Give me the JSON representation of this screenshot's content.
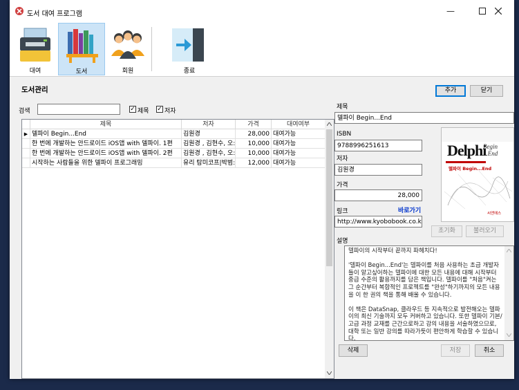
{
  "window": {
    "title": "도서 대여 프로그램",
    "min_icon": "minimize-icon",
    "max_icon": "maximize-icon",
    "close_icon": "close-icon"
  },
  "toolbar": {
    "items": [
      {
        "label": "대여",
        "icon": "rental-printer-icon",
        "selected": false
      },
      {
        "label": "도서",
        "icon": "books-icon",
        "selected": true
      },
      {
        "label": "회원",
        "icon": "members-icon",
        "selected": false
      },
      {
        "label": "종료",
        "icon": "exit-icon",
        "selected": false
      }
    ]
  },
  "page": {
    "title": "도서관리",
    "add_label": "추가",
    "close_label": "닫기"
  },
  "search": {
    "label": "검색",
    "value": "",
    "title_checkbox": "제목",
    "author_checkbox": "저자",
    "title_checked": true,
    "author_checked": true
  },
  "grid": {
    "columns": [
      "제목",
      "저자",
      "가격",
      "대여여부"
    ],
    "rows": [
      {
        "title": "델파이 Begin...End",
        "author": "김원경",
        "price": "28,000",
        "status": "대여가능",
        "current": true
      },
      {
        "title": "한 번에 개발하는 안드로이드 iOS앱 with 델파이. 1편",
        "author": "김원경 , 김현수, 오:",
        "price": "10,000",
        "status": "대여가능",
        "current": false
      },
      {
        "title": "한 번에 개발하는 안드로이드 iOS앱 with 델파이. 2편",
        "author": "김원경 , 김현수, 오:",
        "price": "10,000",
        "status": "대여가능",
        "current": false
      },
      {
        "title": "시작하는 사람들을 위한 델파이 프로그래밍",
        "author": "유리 탐미코프|박범:",
        "price": "12,000",
        "status": "대여가능",
        "current": false
      }
    ]
  },
  "detail": {
    "title_label": "제목",
    "title_value": "델파이 Begin...End",
    "isbn_label": "ISBN",
    "isbn_value": "9788996251613",
    "author_label": "저자",
    "author_value": "김원경",
    "price_label": "가격",
    "price_value": "28,000",
    "link_label": "링크",
    "link_action": "바로가기",
    "link_value": "http://www.kyobobook.co.kr/pro",
    "clear_image_label": "초기화",
    "load_image_label": "불러오기",
    "desc_label": "설명",
    "desc_value": "델파이의 시작부터 끝까지 파헤치다!\n\n'델파이 Begin...End'는 델파이를 처음 사용하는 초급 개발자들이 알고싶어하는 델파이에 대한 모든 내용에 대해 시작부터 중급 수준의 활용까지를 담은 책입니다. 델파이를 \"처음\"켜는 그 순간부터 복합적인 프로젝트를 \"완성\"하기까지의 모든 내용을 이 한 권의 책을 통해 배울 수 있습니다.\n\n이 책은 DataSnap, 클라우드 등 지속적으로 발전해오는 델파이의 최신 기술까지 모두 커버하고 있습니다. 또한 델파이 기본/고급 과정 교재를 근간으로하고 강의 내용을 서술하였으므로, 대학 또는 일반 강의를 따라가듯이 편안하게 학습할 수 있습니다.",
    "delete_label": "삭제",
    "save_label": "저장",
    "cancel_label": "취소"
  },
  "cover": {
    "brand": "Delphi",
    "script": "Begin ...End",
    "subtitle": "델파이 Begin...End",
    "publisher": "씨앤에스"
  }
}
